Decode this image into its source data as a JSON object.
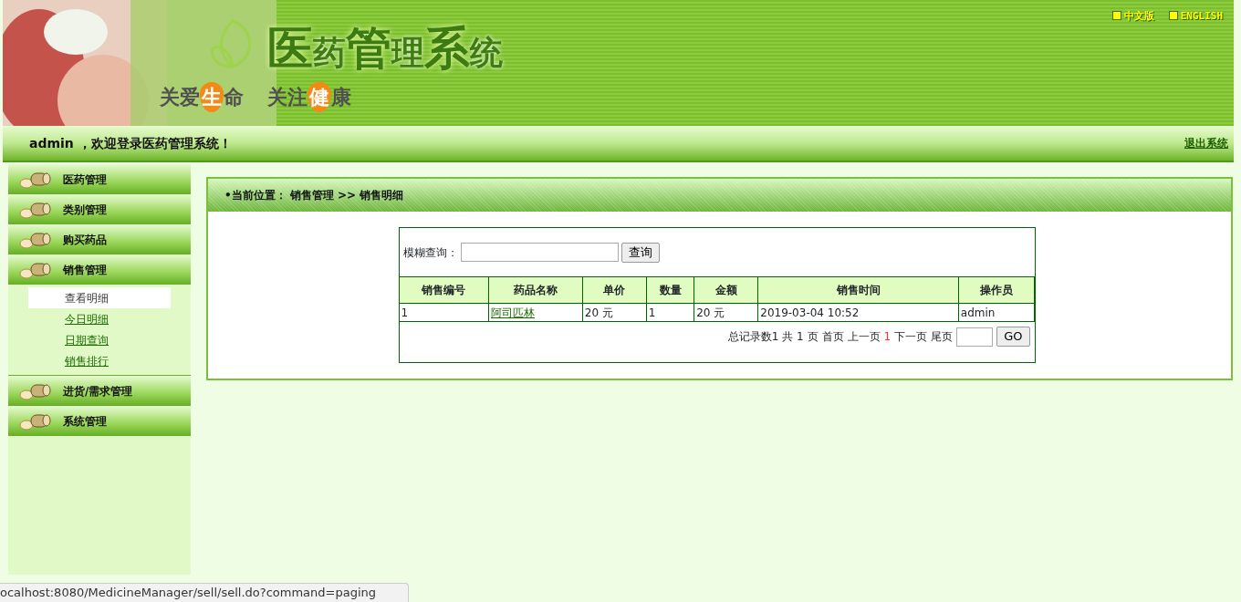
{
  "header": {
    "logo_title": [
      {
        "text": "医",
        "large": true
      },
      {
        "text": "药",
        "large": false
      },
      {
        "text": "管",
        "large": true
      },
      {
        "text": "理",
        "large": false
      },
      {
        "text": "系",
        "large": true
      },
      {
        "text": "统",
        "large": false
      }
    ],
    "slogans": [
      [
        {
          "text": "关爱",
          "highlight": false
        },
        {
          "text": "生",
          "highlight": true
        },
        {
          "text": "命",
          "highlight": false
        }
      ],
      [
        {
          "text": "关注",
          "highlight": false
        },
        {
          "text": "健",
          "highlight": true
        },
        {
          "text": "康",
          "highlight": false
        }
      ]
    ],
    "language_links": [
      "中文版",
      "ENGLISH"
    ]
  },
  "welcome_bar": {
    "message": "admin ，欢迎登录医药管理系统！",
    "logout": "退出系统"
  },
  "sidebar": {
    "items": [
      {
        "label": "医药管理"
      },
      {
        "label": "类别管理"
      },
      {
        "label": "购买药品"
      },
      {
        "label": "销售管理",
        "children": [
          {
            "label": "查看明细",
            "selected": true
          },
          {
            "label": "今日明细",
            "selected": false
          },
          {
            "label": "日期查询",
            "selected": false
          },
          {
            "label": "销售排行",
            "selected": false
          }
        ]
      },
      {
        "label": "进货/需求管理"
      },
      {
        "label": "系统管理"
      }
    ]
  },
  "breadcrumb": "•当前位置： 销售管理 >> 销售明细",
  "search": {
    "label": "模糊查询：",
    "button": "查询"
  },
  "table": {
    "columns": [
      {
        "label": "销售编号",
        "kind": "text"
      },
      {
        "label": "药品名称",
        "kind": "link"
      },
      {
        "label": "单价",
        "kind": "text"
      },
      {
        "label": "数量",
        "kind": "text"
      },
      {
        "label": "金额",
        "kind": "text"
      },
      {
        "label": "销售时间",
        "kind": "text"
      },
      {
        "label": "操作员",
        "kind": "text"
      }
    ],
    "rows": [
      [
        "1",
        "阿司匹林",
        "20 元",
        "1",
        "20 元",
        "2019-03-04 10:52",
        "admin"
      ]
    ]
  },
  "pagination": {
    "summary": "总记录数1 共 1 页",
    "first": "首页",
    "prev": "上一页",
    "current": "1",
    "next": "下一页",
    "last": "尾页",
    "go_button": "GO"
  },
  "status_bar": "ocalhost:8080/MedicineManager/sell/sell.do?command=paging"
}
